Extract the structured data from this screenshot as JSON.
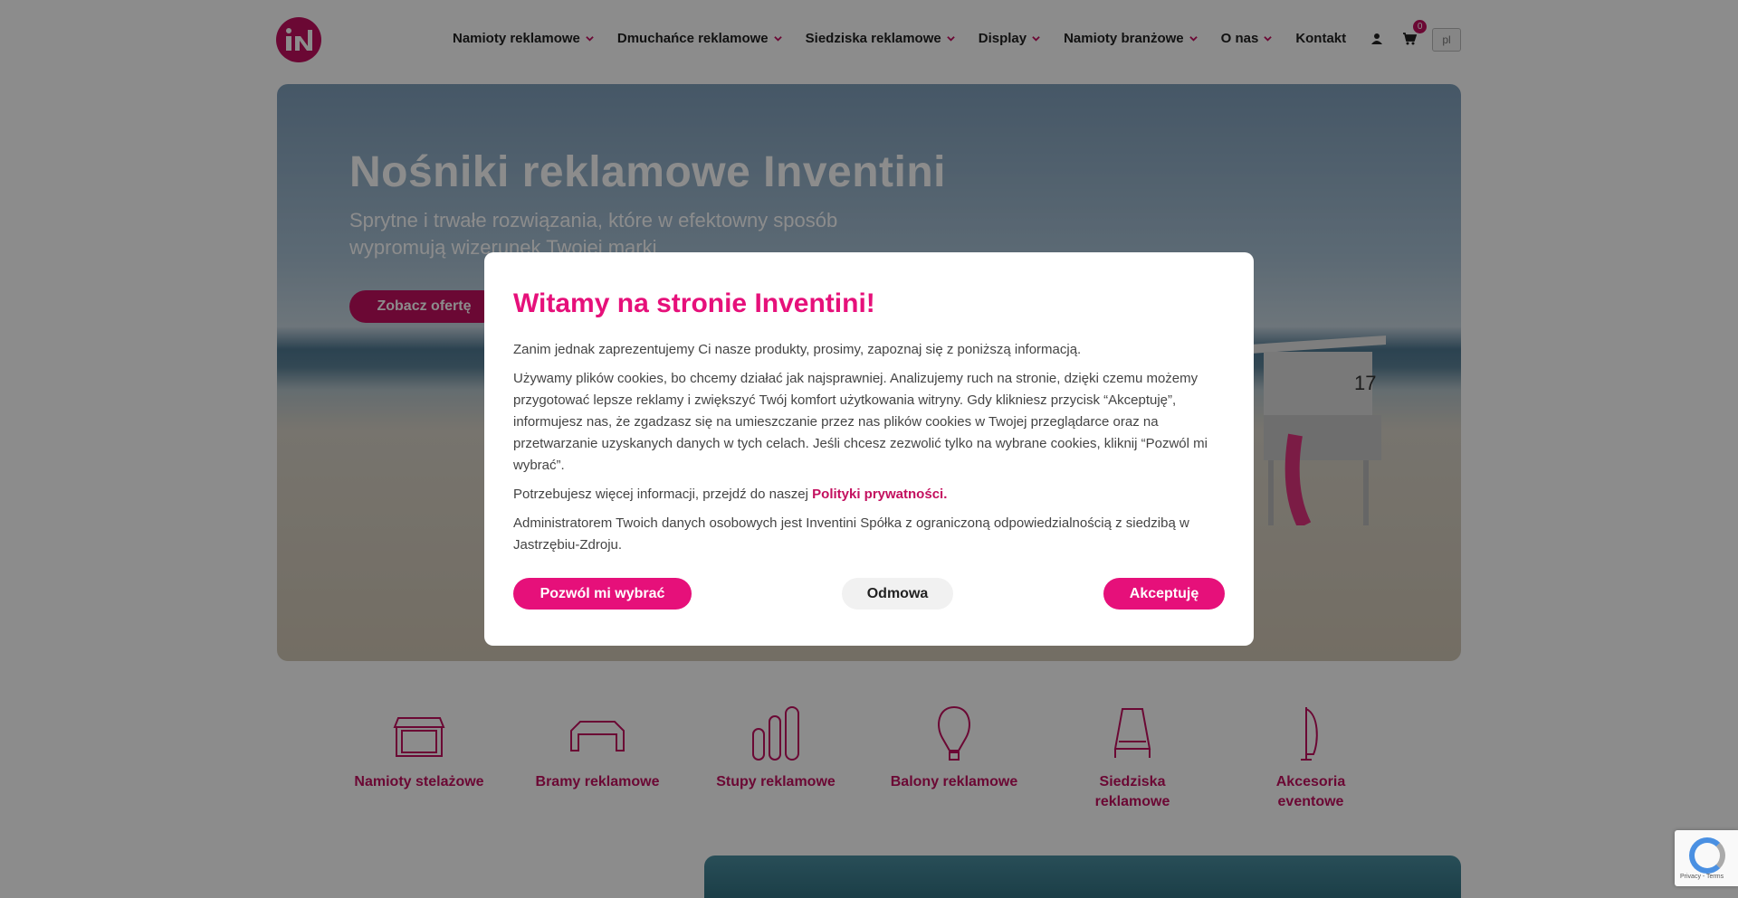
{
  "header": {
    "nav": [
      {
        "label": "Namioty reklamowe",
        "has_dropdown": true
      },
      {
        "label": "Dmuchańce reklamowe",
        "has_dropdown": true
      },
      {
        "label": "Siedziska reklamowe",
        "has_dropdown": true
      },
      {
        "label": "Display",
        "has_dropdown": true
      },
      {
        "label": "Namioty branżowe",
        "has_dropdown": true
      },
      {
        "label": "O nas",
        "has_dropdown": true
      },
      {
        "label": "Kontakt",
        "has_dropdown": false
      }
    ],
    "cart_count": "0",
    "language": "pl",
    "icons": [
      "user-icon",
      "cart-icon"
    ]
  },
  "hero": {
    "title": "Nośniki reklamowe Inventini",
    "subtitle": "Sprytne i trwałe rozwiązania, które w efektowny sposób wypromują wizerunek Twojej marki",
    "button_label": "Zobacz ofertę"
  },
  "categories": [
    {
      "label": "Namioty stelażowe",
      "icon": "tent-icon"
    },
    {
      "label": "Bramy reklamowe",
      "icon": "gate-icon"
    },
    {
      "label": "Stupy reklamowe",
      "icon": "pillars-icon"
    },
    {
      "label": "Balony reklamowe",
      "icon": "balloon-icon"
    },
    {
      "label": "Siedziska reklamowe",
      "icon": "chair-icon"
    },
    {
      "label": "Akcesoria eventowe",
      "icon": "flag-icon"
    }
  ],
  "modal": {
    "title": "Witamy na stronie Inventini!",
    "paragraph1": "Zanim jednak zaprezentujemy Ci nasze produkty, prosimy, zapoznaj się z poniższą informacją.",
    "paragraph2": "Używamy plików cookies, bo chcemy działać jak najsprawniej. Analizujemy ruch na stronie, dzięki czemu możemy przygotować lepsze reklamy i zwiększyć Twój komfort użytkowania witryny. Gdy klikniesz przycisk “Akceptuję”, informujesz nas, że zgadzasz się na umieszczanie przez nas plików cookies w Twojej przeglądarce oraz na przetwarzanie uzyskanych danych w tych celach. Jeśli chcesz zezwolić tylko na wybrane cookies, kliknij “Pozwól mi wybrać”.",
    "paragraph3_prefix": "Potrzebujesz więcej informacji, przejdź do naszej ",
    "paragraph3_link": "Polityki prywatności.",
    "paragraph4": "Administratorem Twoich danych osobowych jest Inventini Spółka z ograniczoną odpowiedzialnością z siedzibą w Jastrzębiu-Zdroju.",
    "btn_choose": "Pozwól mi wybrać",
    "btn_reject": "Odmowa",
    "btn_accept": "Akceptuję"
  },
  "recaptcha": {
    "text": "Privacy - Terms"
  },
  "colors": {
    "brand": "#c3105f",
    "accent": "#e6107a"
  }
}
